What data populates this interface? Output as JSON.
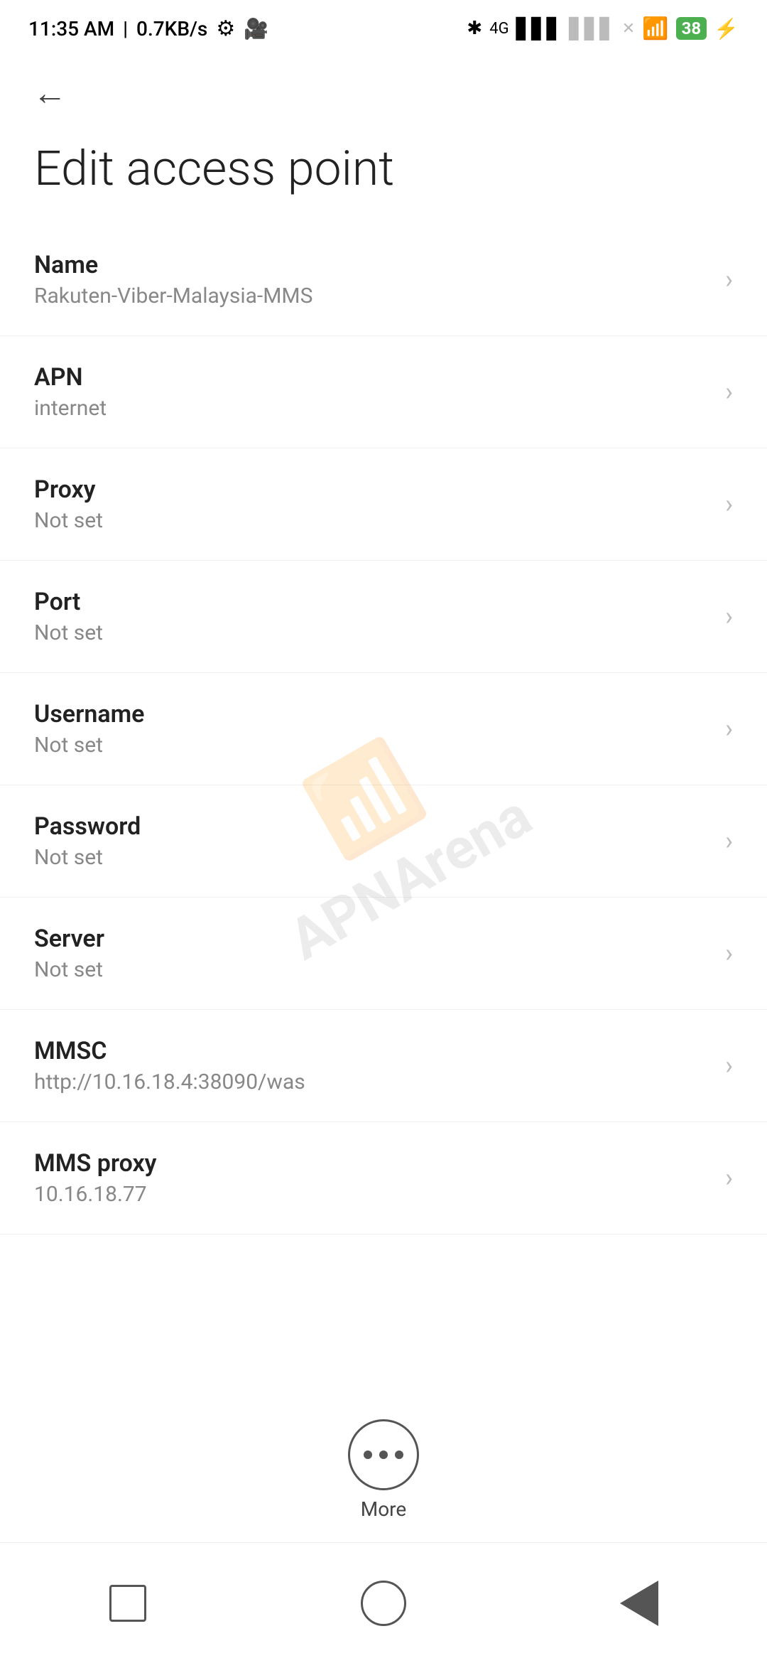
{
  "statusBar": {
    "time": "11:35 AM",
    "speed": "0.7KB/s"
  },
  "toolbar": {
    "backLabel": "←"
  },
  "page": {
    "title": "Edit access point"
  },
  "settings": [
    {
      "id": "name",
      "title": "Name",
      "value": "Rakuten-Viber-Malaysia-MMS"
    },
    {
      "id": "apn",
      "title": "APN",
      "value": "internet"
    },
    {
      "id": "proxy",
      "title": "Proxy",
      "value": "Not set"
    },
    {
      "id": "port",
      "title": "Port",
      "value": "Not set"
    },
    {
      "id": "username",
      "title": "Username",
      "value": "Not set"
    },
    {
      "id": "password",
      "title": "Password",
      "value": "Not set"
    },
    {
      "id": "server",
      "title": "Server",
      "value": "Not set"
    },
    {
      "id": "mmsc",
      "title": "MMSC",
      "value": "http://10.16.18.4:38090/was"
    },
    {
      "id": "mms-proxy",
      "title": "MMS proxy",
      "value": "10.16.18.77"
    }
  ],
  "bottomBar": {
    "moreLabel": "More"
  }
}
